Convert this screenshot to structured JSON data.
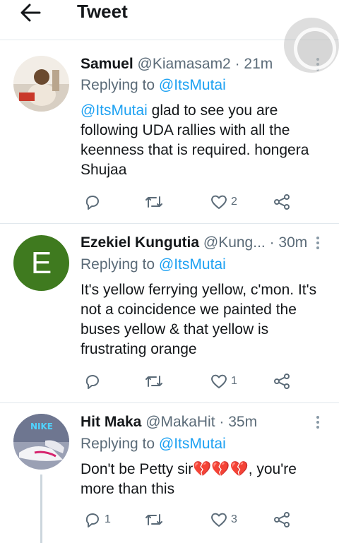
{
  "header": {
    "title": "Tweet"
  },
  "tweets": [
    {
      "name": "Samuel",
      "handle": "@Kiamasam2",
      "time": "21m",
      "replying_prefix": "Replying to ",
      "replying_to": "@ItsMutai",
      "mention": "@ItsMutai",
      "text": " glad to see you are following UDA rallies with all the keenness that is required. hongera Shujaa",
      "replies": "",
      "retweets": "",
      "likes": "2"
    },
    {
      "name": "Ezekiel Kungutia",
      "handle": "@Kung...",
      "time": "30m",
      "avatar_letter": "E",
      "replying_prefix": "Replying to ",
      "replying_to": "@ItsMutai",
      "text": "It's yellow ferrying yellow, c'mon. It's not a coincidence we painted the buses yellow & that yellow is frustrating orange",
      "replies": "",
      "retweets": "",
      "likes": "1"
    },
    {
      "name": "Hit Maka",
      "handle": "@MakaHit",
      "time": "35m",
      "replying_prefix": "Replying to ",
      "replying_to": "@ItsMutai",
      "text_before": "Don't be Petty sir",
      "emoji": "💔💔💔",
      "text_after": ", you're more than this",
      "replies": "1",
      "retweets": "",
      "likes": "3"
    }
  ],
  "colors": {
    "accent": "#1da1f2",
    "muted": "#5b6b78",
    "divider": "#e1e8ed",
    "avatar_e": "#3f7a1f"
  },
  "icons": [
    "back-arrow-icon",
    "more-vertical-icon",
    "reply-icon",
    "retweet-icon",
    "like-icon",
    "share-icon"
  ]
}
